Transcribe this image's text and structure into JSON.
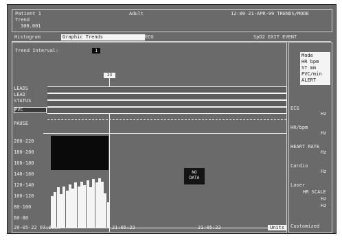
{
  "header": {
    "left_top": "Patient 1",
    "left_mid": "Trend",
    "left_bottom": "300.001",
    "center": "Adult",
    "right": "12:00 21-APR-99 TRENDS/MODE"
  },
  "tabs": [
    {
      "label": "Histogram",
      "active": false
    },
    {
      "label": "Graphic Trends",
      "active": true
    },
    {
      "label": "ECG",
      "active": false
    },
    {
      "label": "SpO2 EXIT EVENT",
      "active": false
    }
  ],
  "panel": {
    "title": "Trend Interval:",
    "interval_value": "1",
    "cursor_tag": "23",
    "row_labels": [
      "LEADS",
      "LEAD",
      "STATUS",
      "PVC",
      "PAUSE"
    ],
    "y_labels": [
      "40-60",
      "60-80",
      "80-100",
      "100-120",
      "120-140",
      "140-160",
      "160-180",
      "180-200",
      "200-220"
    ],
    "x_labels": [
      "20-05-22 07:00am",
      "21:05:22",
      "21:05:22",
      "Units"
    ],
    "no_data_label": [
      "NO",
      "DATA"
    ]
  },
  "sidebar": {
    "top_block": [
      "Mode",
      "HR bpm",
      "ST mm",
      "PVC/min",
      "ALERT"
    ],
    "items": [
      "ECG",
      "Hz",
      "HR/bpm",
      "Hz",
      "HEART RATE",
      "Hz",
      "Cardio",
      "Hz",
      "Laser",
      "HR SCALE",
      "Hz",
      "Hz",
      "Customized"
    ]
  },
  "colors": {
    "background": "#6a6a6a",
    "foreground": "#f4f4f4",
    "dark": "#0a0a0a"
  },
  "histogram": {
    "values": [
      0.55,
      0.62,
      0.7,
      0.58,
      0.72,
      0.64,
      0.75,
      0.68,
      0.78,
      0.72,
      0.8,
      0.74,
      0.82,
      0.7,
      0.84,
      0.78,
      0.86,
      0.8,
      0.6,
      0.44
    ]
  }
}
